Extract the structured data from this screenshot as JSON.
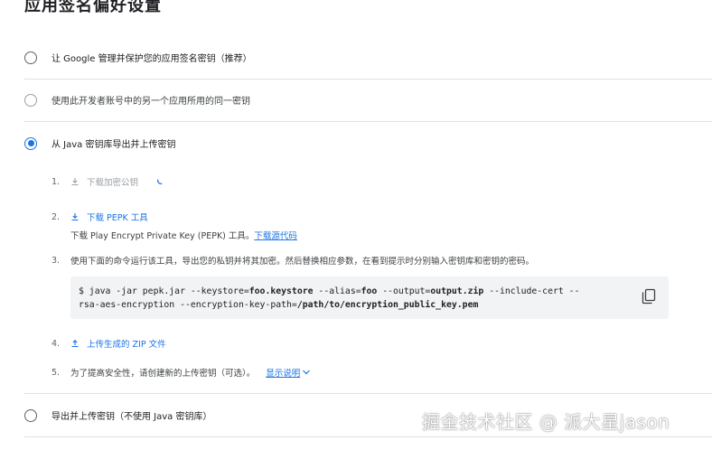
{
  "page": {
    "title": "应用签名偏好设置"
  },
  "options": [
    {
      "label": "让 Google 管理并保护您的应用签名密钥（推荐）",
      "state": "unchecked"
    },
    {
      "label": "使用此开发者账号中的另一个应用所用的同一密钥",
      "state": "disabled"
    },
    {
      "label": "从 Java 密钥库导出并上传密钥",
      "state": "checked"
    },
    {
      "label": "导出并上传密钥（不使用 Java 密钥库）",
      "state": "unchecked"
    }
  ],
  "steps": {
    "s1": {
      "num": "1.",
      "label": "下载加密公钥",
      "icon": "download-icon"
    },
    "s2": {
      "num": "2.",
      "label": "下载 PEPK 工具",
      "icon": "download-icon",
      "desc": "下载 Play Encrypt Private Key (PEPK) 工具。",
      "desc_link": "下载源代码"
    },
    "s3": {
      "num": "3.",
      "text": "使用下面的命令运行该工具，导出您的私钥并将其加密。然后替换相应参数，在看到提示时分别输入密钥库和密钥的密码。"
    },
    "s4": {
      "num": "4.",
      "label": "上传生成的 ZIP 文件",
      "icon": "upload-icon"
    },
    "s5": {
      "num": "5.",
      "text": "为了提高安全性，请创建新的上传密钥（可选）。",
      "link": "显示说明"
    }
  },
  "code": {
    "l1_a": "$ java -jar pepk.jar --keystore=",
    "l1_b": "foo.keystore",
    "l1_c": " --alias=",
    "l1_d": "foo",
    "l1_e": " --output=",
    "l1_f": "output.zip",
    "l1_g": " --include-cert --",
    "l2_a": "rsa-aes-encryption --encryption-key-path=",
    "l2_b": "/path/to/encryption_public_key.pem"
  },
  "watermark": "掘金技术社区 @ 派大星jason",
  "colors": {
    "accent": "#1a73e8",
    "divider": "#e0e0e0",
    "code_bg": "#f1f3f4"
  }
}
